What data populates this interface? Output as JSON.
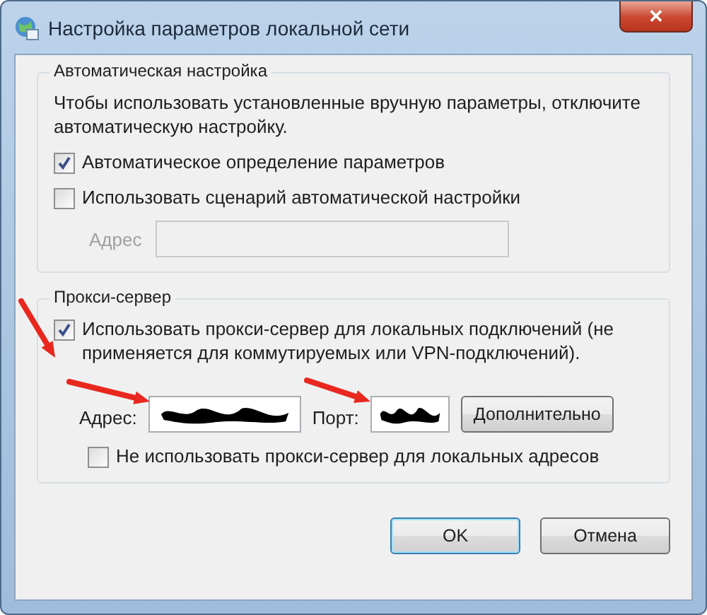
{
  "window": {
    "title": "Настройка параметров локальной сети",
    "close": "✕"
  },
  "auto_group": {
    "title": "Автоматическая настройка",
    "note": "Чтобы использовать установленные вручную параметры, отключите автоматическую настройку.",
    "options": [
      {
        "label": "Автоматическое определение параметров",
        "checked": true
      },
      {
        "label": "Использовать сценарий автоматической настройки",
        "checked": false
      }
    ],
    "address": {
      "label": "Адрес",
      "disabled": true
    }
  },
  "proxy_group": {
    "title": "Прокси-сервер",
    "use_proxy": {
      "label": "Использовать прокси-сервер для локальных подключений (не применяется для коммутируемых или VPN-подключений).",
      "checked": true
    },
    "address": {
      "label": "Адрес:",
      "redacted": true
    },
    "port": {
      "label": "Порт:",
      "redacted": true
    },
    "advanced_button": "Дополнительно",
    "bypass_local": {
      "label": "Не использовать прокси-сервер для локальных адресов",
      "checked": false
    }
  },
  "buttons": [
    {
      "label": "OK",
      "default": true
    },
    {
      "label": "Отмена",
      "default": false
    }
  ],
  "annotations": [
    {
      "kind": "arrow"
    },
    {
      "kind": "arrow"
    },
    {
      "kind": "arrow"
    }
  ]
}
